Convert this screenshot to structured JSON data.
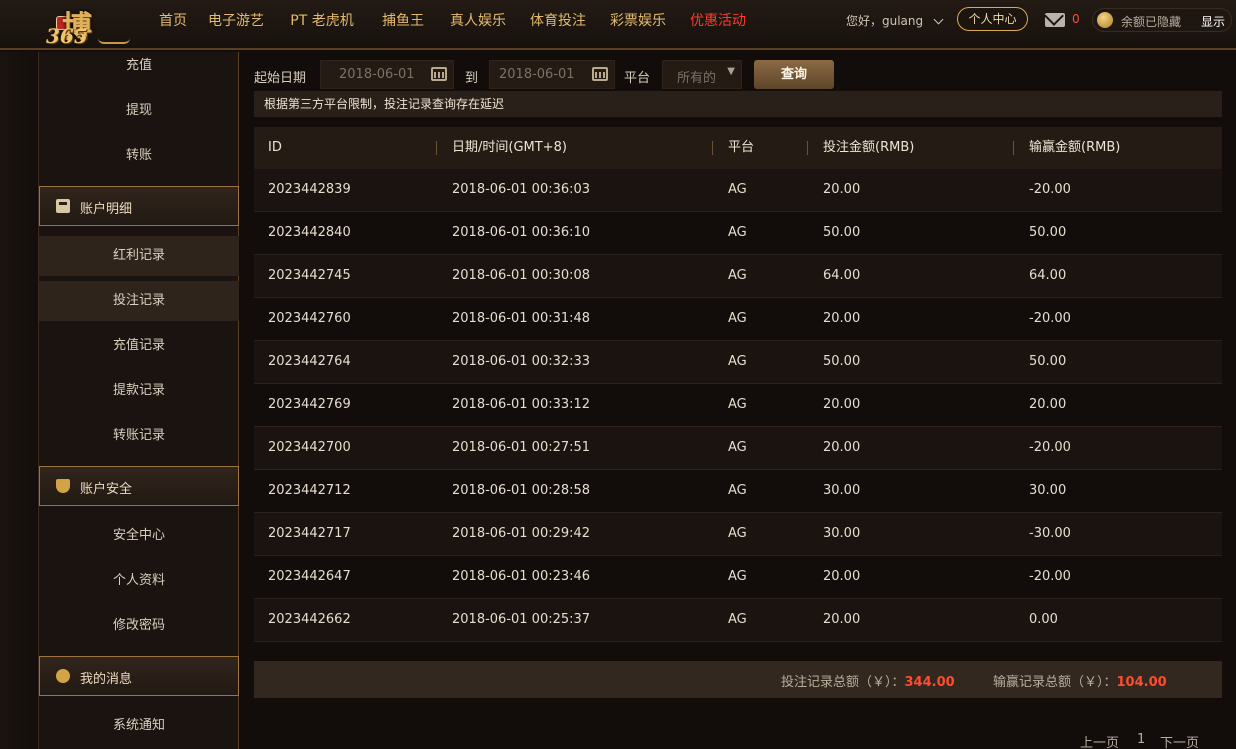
{
  "logo": {
    "main_text": "博",
    "sub_text": "365"
  },
  "nav": {
    "items": [
      "首页",
      "电子游艺",
      "PT 老虎机",
      "捕鱼王",
      "真人娱乐",
      "体育投注",
      "彩票娱乐",
      "优惠活动"
    ],
    "active_index": 7
  },
  "user": {
    "greeting": "您好，gulang",
    "center_button": "个人中心",
    "mail_count": "0",
    "balance_text": "余额已隐藏",
    "show_label": "显示"
  },
  "sidebar": {
    "top_items": [
      "充值",
      "提现",
      "转账"
    ],
    "group1": {
      "title": "账户明细",
      "items": [
        "红利记录",
        "投注记录",
        "充值记录",
        "提款记录",
        "转账记录"
      ]
    },
    "group2": {
      "title": "账户安全",
      "items": [
        "安全中心",
        "个人资料",
        "修改密码"
      ]
    },
    "group3": {
      "title": "我的消息",
      "items": [
        "系统通知"
      ]
    }
  },
  "filter": {
    "start_label": "起始日期",
    "start_value": "2018-06-01",
    "to_label": "到",
    "end_value": "2018-06-01",
    "platform_label": "平台",
    "platform_value": "所有的",
    "query_button": "查询"
  },
  "notice": "根据第三方平台限制，投注记录查询存在延迟",
  "table": {
    "headers": [
      "ID",
      "日期/时间(GMT+8)",
      "平台",
      "投注金额(RMB)",
      "输赢金额(RMB)"
    ],
    "rows": [
      [
        "2023442839",
        "2018-06-01 00:36:03",
        "AG",
        "20.00",
        "-20.00"
      ],
      [
        "2023442840",
        "2018-06-01 00:36:10",
        "AG",
        "50.00",
        "50.00"
      ],
      [
        "2023442745",
        "2018-06-01 00:30:08",
        "AG",
        "64.00",
        "64.00"
      ],
      [
        "2023442760",
        "2018-06-01 00:31:48",
        "AG",
        "20.00",
        "-20.00"
      ],
      [
        "2023442764",
        "2018-06-01 00:32:33",
        "AG",
        "50.00",
        "50.00"
      ],
      [
        "2023442769",
        "2018-06-01 00:33:12",
        "AG",
        "20.00",
        "20.00"
      ],
      [
        "2023442700",
        "2018-06-01 00:27:51",
        "AG",
        "20.00",
        "-20.00"
      ],
      [
        "2023442712",
        "2018-06-01 00:28:58",
        "AG",
        "30.00",
        "30.00"
      ],
      [
        "2023442717",
        "2018-06-01 00:29:42",
        "AG",
        "30.00",
        "-30.00"
      ],
      [
        "2023442647",
        "2018-06-01 00:23:46",
        "AG",
        "20.00",
        "-20.00"
      ],
      [
        "2023442662",
        "2018-06-01 00:25:37",
        "AG",
        "20.00",
        "0.00"
      ]
    ]
  },
  "summary": {
    "bet_total_label": "投注记录总额（￥）：",
    "bet_total_value": "344.00",
    "win_total_label": "输赢记录总额（￥）：",
    "win_total_value": "104.00"
  },
  "pager": {
    "prev": "上一页",
    "current": "1",
    "next": "下一页"
  },
  "colors": {
    "accent_gold": "#e3b96d",
    "active_red": "#ff3b2e",
    "total_red": "#ff4b2e"
  }
}
